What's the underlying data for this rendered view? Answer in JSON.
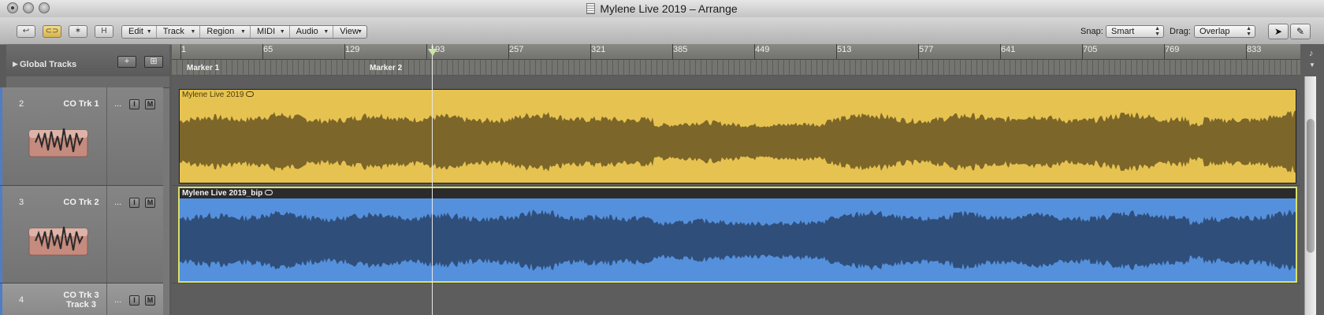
{
  "window": {
    "title": "Mylene Live 2019 – Arrange"
  },
  "toolbar": {
    "menus": [
      "Edit",
      "Track",
      "Region",
      "MIDI",
      "Audio",
      "View"
    ],
    "snap_label": "Snap:",
    "snap_value": "Smart",
    "drag_label": "Drag:",
    "drag_value": "Overlap",
    "btn_hide": "H"
  },
  "global_tracks": {
    "label": "Global Tracks"
  },
  "ruler": {
    "ticks": [
      "1",
      "65",
      "129",
      "193",
      "257",
      "321",
      "385",
      "449",
      "513",
      "577",
      "641",
      "705",
      "769",
      "833"
    ],
    "markers": [
      "Marker 1",
      "Marker 2"
    ]
  },
  "tracks": [
    {
      "number": "2",
      "name": "CO Trk 1",
      "dots": "...",
      "input_btn": "I",
      "mute_btn": "M"
    },
    {
      "number": "3",
      "name": "CO Trk 2",
      "dots": "...",
      "input_btn": "I",
      "mute_btn": "M"
    },
    {
      "number": "4",
      "name": "CO Trk 3",
      "subname": "Track 3",
      "dots": "...",
      "input_btn": "I",
      "mute_btn": "M"
    }
  ],
  "regions": [
    {
      "name": "Mylene Live 2019",
      "color": "#e6c350",
      "wave_color": "#7d6629"
    },
    {
      "name": "Mylene Live 2019_bip",
      "color": "#5590dd",
      "wave_color": "#2f4f7a"
    }
  ]
}
